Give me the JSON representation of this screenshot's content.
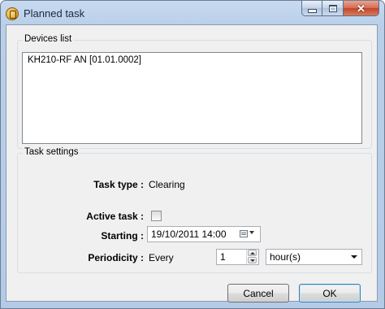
{
  "window": {
    "title": "Planned task"
  },
  "devices": {
    "legend": "Devices list",
    "items": [
      "KH210-RF AN [01.01.0002]"
    ]
  },
  "settings": {
    "legend": "Task settings",
    "task_type_label": "Task type :",
    "task_type_value": "Clearing",
    "active_label": "Active task :",
    "active_checked": false,
    "starting_label": "Starting :",
    "starting_value": "19/10/2011 14:00",
    "periodicity_label": "Periodicity :",
    "periodicity_every": "Every",
    "periodicity_count": "1",
    "periodicity_unit": "hour(s)"
  },
  "buttons": {
    "cancel": "Cancel",
    "ok": "OK"
  },
  "icons": {
    "app": "app-icon",
    "minimize": "minimize-icon",
    "maximize": "maximize-icon",
    "close": "close-icon"
  }
}
